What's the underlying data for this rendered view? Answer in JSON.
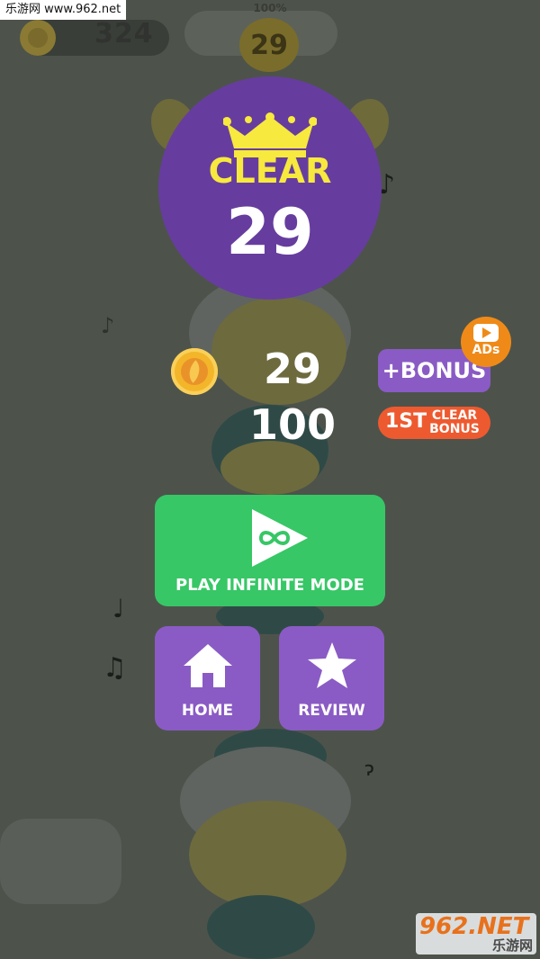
{
  "watermark": {
    "top": "乐游网 www.962.net",
    "bottom_main": "962.NET",
    "bottom_sub": "乐游网"
  },
  "hud": {
    "coin_total": "324",
    "progress_percent": "100%",
    "level": "29"
  },
  "result": {
    "clear_title": "CLEAR",
    "level": "29",
    "coin_reward": "29",
    "first_clear_reward": "100"
  },
  "buttons": {
    "bonus_label": "+BONUS",
    "ads_label": "ADs",
    "first_clear_num": "1ST",
    "first_clear_text": "CLEAR BONUS",
    "play_label": "PLAY INFINITE MODE",
    "home_label": "HOME",
    "review_label": "REVIEW"
  },
  "icons": [
    "coin-icon",
    "crown-icon",
    "play-infinite-icon",
    "home-icon",
    "star-icon",
    "play-video-icon",
    "music-note-icon"
  ],
  "colors": {
    "clear_circle": "#663d9e",
    "play_green": "#37c766",
    "purple_button": "#8a5bc4",
    "ads_orange": "#ef8a18",
    "first_clear_red": "#ee5a2f",
    "crown_yellow": "#f7e93e"
  }
}
